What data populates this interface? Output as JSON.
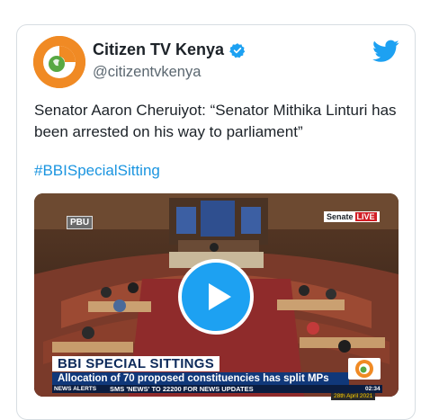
{
  "account": {
    "name": "Citizen TV Kenya",
    "handle": "@citizentvkenya",
    "verified_icon": "verified-badge-icon",
    "brand_color": "#f08a24"
  },
  "tweet": {
    "text": "Senator Aaron Cheruiyot: “Senator Mithika Linturi has been arrested on his way to parliament”",
    "hashtag": "#BBISpecialSitting"
  },
  "video": {
    "channel_badge": "PBU",
    "senate_label": "Senate",
    "live_label": "LIVE",
    "lower_third_title": "BBI SPECIAL SITTINGS",
    "lower_third_sub": "Allocation of 70 proposed constituencies has split MPs",
    "ticker_label": "NEWS ALERTS",
    "ticker_text": "SMS 'NEWS' TO 22200 FOR NEWS UPDATES",
    "ticker_time": "02:34 PM",
    "ticker_date": "28th April 2021"
  },
  "colors": {
    "link": "#1b95e0",
    "play": "#1da1f2",
    "lower_third_blue": "#10387a"
  }
}
